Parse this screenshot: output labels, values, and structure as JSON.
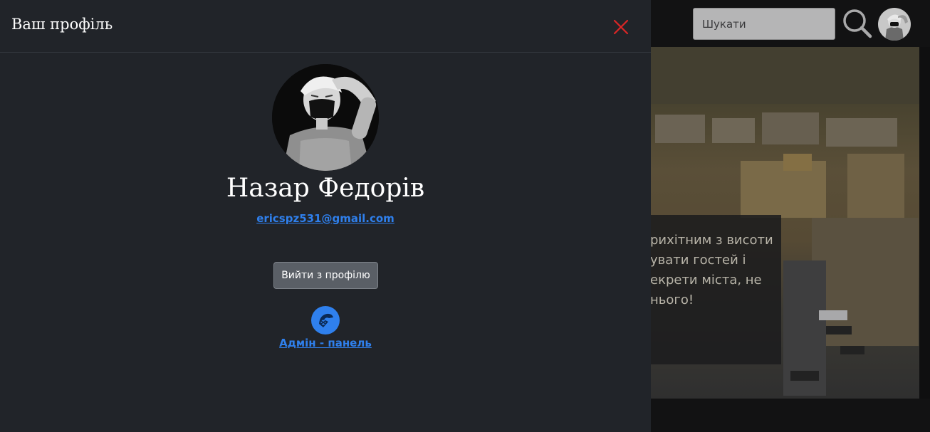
{
  "header": {
    "search": {
      "placeholder": "Шукати",
      "value": ""
    }
  },
  "hero": {
    "text": "рихітним з висоти\nувати гостей і\nекрети міста, не\nнього!"
  },
  "profile_panel": {
    "title": "Ваш профіль",
    "user_name": "Назар Федорів",
    "email": "ericspz531@gmail.com",
    "logout_label": "Вийти з профілю",
    "admin_label": "Адмін - панель"
  },
  "colors": {
    "panel_bg": "#212429",
    "close_icon": "#dc2626",
    "link": "#2f80ed",
    "logout_button": "#5a5f66"
  },
  "icons": [
    "close-icon",
    "search-icon",
    "admin-panel-icon",
    "user-avatar"
  ]
}
